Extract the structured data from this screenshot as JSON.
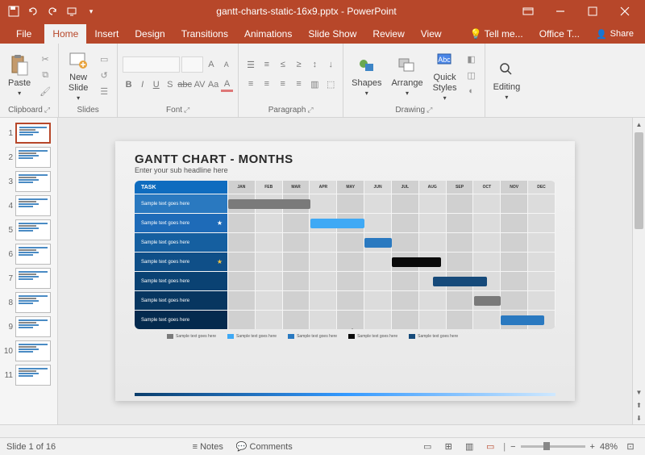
{
  "app_name": "PowerPoint",
  "document": "gantt-charts-static-16x9.pptx",
  "tabs": {
    "file": "File",
    "home": "Home",
    "insert": "Insert",
    "design": "Design",
    "transitions": "Transitions",
    "animations": "Animations",
    "slideshow": "Slide Show",
    "review": "Review",
    "view": "View",
    "tellme": "Tell me...",
    "office_tab": "Office T...",
    "share": "Share"
  },
  "groups": {
    "clipboard": "Clipboard",
    "slides": "Slides",
    "font": "Font",
    "paragraph": "Paragraph",
    "drawing": "Drawing",
    "editing": "Editing"
  },
  "buttons": {
    "paste": "Paste",
    "new_slide": "New\nSlide",
    "shapes": "Shapes",
    "arrange": "Arrange",
    "quick_styles": "Quick\nStyles",
    "editing": "Editing"
  },
  "slide": {
    "title": "GANTT CHART - MONTHS",
    "subtitle": "Enter your sub headline here",
    "task_header": "TASK",
    "months": [
      "JAN",
      "FEB",
      "MAR",
      "APR",
      "MAY",
      "JUN",
      "JUL",
      "AUG",
      "SEP",
      "OCT",
      "NOV",
      "DEC"
    ],
    "rows": [
      {
        "label": "Sample text goes here",
        "bg": "#2a79c0",
        "star": "",
        "bar": {
          "from": 0,
          "span": 3,
          "color": "#7a7a7a"
        }
      },
      {
        "label": "Sample text goes here",
        "bg": "#1e6bb8",
        "star": "★",
        "star_color": "#fff",
        "bar": {
          "from": 3,
          "span": 2,
          "color": "#3fa9f5"
        }
      },
      {
        "label": "Sample text goes here",
        "bg": "#155fa0",
        "star": "",
        "bar": {
          "from": 5,
          "span": 1,
          "color": "#2a79c0"
        }
      },
      {
        "label": "Sample text goes here",
        "bg": "#0f4f88",
        "star": "★",
        "star_color": "#f4c542",
        "bar": {
          "from": 6,
          "span": 1.8,
          "color": "#0a0a0a"
        }
      },
      {
        "label": "Sample text goes here",
        "bg": "#0a4273",
        "star": "",
        "bar": {
          "from": 7.5,
          "span": 2,
          "color": "#164a7a"
        }
      },
      {
        "label": "Sample text goes here",
        "bg": "#073660",
        "star": "",
        "bar": {
          "from": 9,
          "span": 1,
          "color": "#7a7a7a"
        }
      },
      {
        "label": "Sample text goes here",
        "bg": "#042a4e",
        "star": "",
        "bar": {
          "from": 10,
          "span": 1.6,
          "color": "#2a79c0"
        }
      }
    ],
    "legend": [
      {
        "label": "Sample text goes here",
        "color": "#7a7a7a"
      },
      {
        "label": "Sample text goes here",
        "color": "#3fa9f5"
      },
      {
        "label": "Sample text goes here",
        "color": "#2a79c0"
      },
      {
        "label": "Sample text goes here",
        "color": "#0a0a0a"
      },
      {
        "label": "Sample text goes here",
        "color": "#164a7a"
      }
    ]
  },
  "thumbnails": [
    1,
    2,
    3,
    4,
    5,
    6,
    7,
    8,
    9,
    10,
    11
  ],
  "status": {
    "slide_info": "Slide 1 of 16",
    "lang": "",
    "notes": "Notes",
    "comments": "Comments",
    "zoom": "48%"
  }
}
